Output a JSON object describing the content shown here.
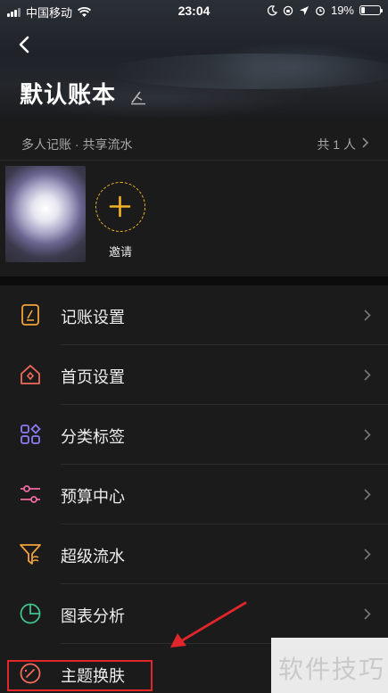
{
  "status_bar": {
    "carrier": "中国移动",
    "time": "23:04",
    "battery": "19%",
    "battery_level": 0.19
  },
  "header": {
    "title": "默认账本"
  },
  "share": {
    "label": "多人记账 · 共享流水",
    "count": "共 1 人"
  },
  "members": {
    "invite_label": "邀请"
  },
  "menu": {
    "items": [
      {
        "label": "记账设置",
        "icon": "ledger-edit-icon",
        "color": "#f0a23a"
      },
      {
        "label": "首页设置",
        "icon": "home-icon",
        "color": "#f26b5b"
      },
      {
        "label": "分类标签",
        "icon": "category-icon",
        "color": "#8b7cf6"
      },
      {
        "label": "预算中心",
        "icon": "budget-sliders-icon",
        "color": "#f06aa0"
      },
      {
        "label": "超级流水",
        "icon": "funnel-icon",
        "color": "#f0a23a"
      },
      {
        "label": "图表分析",
        "icon": "pie-chart-icon",
        "color": "#3fc28a"
      },
      {
        "label": "主题换肤",
        "icon": "theme-palette-icon",
        "color": "#f26b5b"
      }
    ]
  },
  "annotation": {
    "highlight_color": "#e0262b"
  },
  "watermark": {
    "text": "软件技巧"
  }
}
